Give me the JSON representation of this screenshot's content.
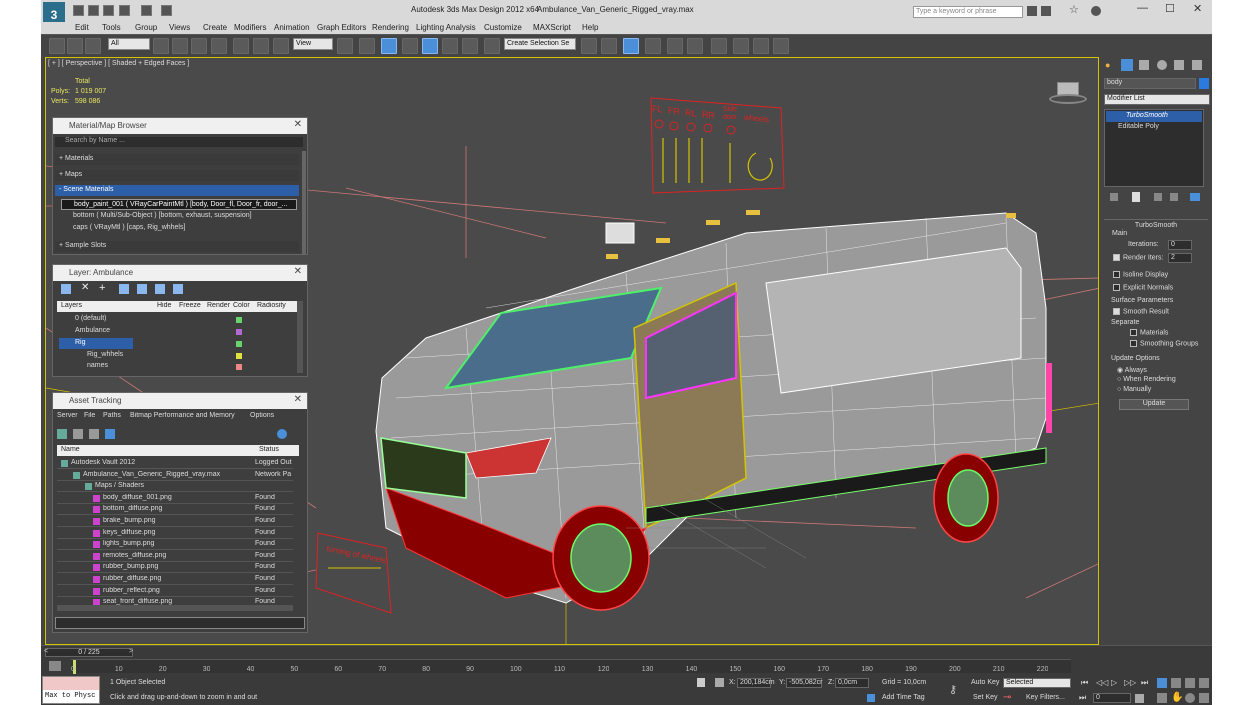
{
  "titlebar": {
    "app": "Autodesk 3ds Max Design 2012 x64",
    "file": "Ambulance_Van_Generic_Rigged_vray.max",
    "search_placeholder": "Type a keyword or phrase"
  },
  "menu": [
    "Edit",
    "Tools",
    "Group",
    "Views",
    "Create",
    "Modifiers",
    "Animation",
    "Graph Editors",
    "Rendering",
    "Lighting Analysis",
    "Customize",
    "MAXScript",
    "Help"
  ],
  "toolbar": {
    "filter": "All",
    "ref_coord": "View",
    "selection_set": "Create Selection Se"
  },
  "viewport": {
    "label": "[ + ] [ Perspective ] [ Shaded + Edged Faces ]",
    "stats": {
      "total": "Total",
      "polys_label": "Polys:",
      "polys": "1 019 007",
      "verts_label": "Verts:",
      "verts": "598 086"
    },
    "sign_labels": [
      "FL",
      "FR",
      "RL",
      "RR",
      "Side door",
      "wheels"
    ],
    "front_sign": "turning of wheels"
  },
  "material_browser": {
    "title": "Material/Map Browser",
    "search": "Search by Name ...",
    "groups": [
      "+ Materials",
      "+ Maps",
      "- Scene Materials"
    ],
    "items": [
      "body_paint_001 ( VRayCarPaintMtl ) [body, Door_fl, Door_fr, door_...",
      "bottom ( Multi/Sub-Object ) [bottom, exhaust, suspension]",
      "caps ( VRayMtl ) [caps, Rig_whhels]"
    ],
    "sample": "+ Sample Slots"
  },
  "layers": {
    "title": "Layer: Ambulance",
    "columns": [
      "Layers",
      "Hide",
      "Freeze",
      "Render",
      "Color",
      "Radiosity"
    ],
    "rows": [
      "0 (default)",
      "Ambulance",
      "Rig",
      "Rig_whhels",
      "names"
    ]
  },
  "assets": {
    "title": "Asset Tracking",
    "menu": [
      "Server",
      "File",
      "Paths",
      "Bitmap Performance and Memory",
      "Options"
    ],
    "columns": [
      "Name",
      "Status"
    ],
    "rows": [
      {
        "name": "Autodesk Vault 2012",
        "status": "Logged Out"
      },
      {
        "name": "Ambulance_Van_Generic_Rigged_vray.max",
        "status": "Network Pa"
      },
      {
        "name": "Maps / Shaders",
        "status": ""
      },
      {
        "name": "body_diffuse_001.png",
        "status": "Found"
      },
      {
        "name": "bottom_diffuse.png",
        "status": "Found"
      },
      {
        "name": "brake_bump.png",
        "status": "Found"
      },
      {
        "name": "keys_diffuse.png",
        "status": "Found"
      },
      {
        "name": "lights_bump.png",
        "status": "Found"
      },
      {
        "name": "remotes_diffuse.png",
        "status": "Found"
      },
      {
        "name": "rubber_bump.png",
        "status": "Found"
      },
      {
        "name": "rubber_diffuse.png",
        "status": "Found"
      },
      {
        "name": "rubber_reflect.png",
        "status": "Found"
      },
      {
        "name": "seat_front_diffuse.png",
        "status": "Found"
      }
    ]
  },
  "command_panel": {
    "object_name": "body",
    "modifier_list": "Modifier List",
    "stack": [
      "TurboSmooth",
      "Editable Poly"
    ],
    "rollout": "TurboSmooth",
    "main": "Main",
    "iterations_label": "Iterations:",
    "iterations": "0",
    "render_iters_label": "Render Iters:",
    "render_iters": "2",
    "isoline": "Isoline Display",
    "explicit": "Explicit Normals",
    "surface": "Surface Parameters",
    "smooth": "Smooth Result",
    "separate": "Separate",
    "materials": "Materials",
    "smoothing": "Smoothing Groups",
    "update_opts": "Update Options",
    "always": "Always",
    "when_rendering": "When Rendering",
    "manually": "Manually",
    "update_btn": "Update"
  },
  "timeline": {
    "frame": "0 / 225",
    "ticks": [
      "0",
      "10",
      "20",
      "30",
      "40",
      "50",
      "60",
      "70",
      "80",
      "90",
      "100",
      "110",
      "120",
      "130",
      "140",
      "150",
      "160",
      "170",
      "180",
      "190",
      "200",
      "210",
      "220"
    ]
  },
  "status": {
    "script": "Max to Physc",
    "selected": "1 Object Selected",
    "prompt": "Click and drag up-and-down to zoom in and out",
    "x_label": "X:",
    "x": "200,184cm",
    "y_label": "Y:",
    "y": "-505,082cr",
    "z_label": "Z:",
    "z": "0,0cm",
    "grid": "Grid = 10,0cm",
    "autokey": "Auto Key",
    "selected_dd": "Selected",
    "setkey": "Set Key",
    "keyfilters": "Key Filters...",
    "add_time_tag": "Add Time Tag",
    "frame_field": "0"
  }
}
